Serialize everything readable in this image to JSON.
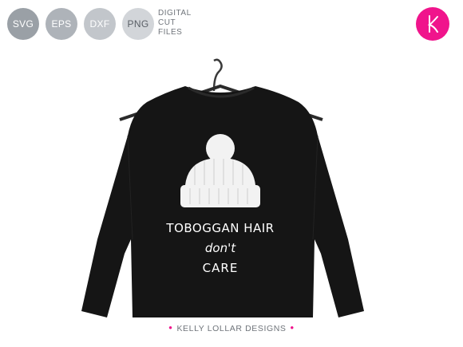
{
  "formats": [
    "SVG",
    "EPS",
    "DXF",
    "PNG"
  ],
  "digital_label": [
    "DIGITAL",
    "CUT",
    "FILES"
  ],
  "logo": {
    "letter": "K",
    "color": "#f0148c"
  },
  "design": {
    "line1": "TOBOGGAN HAIR",
    "line2": "don't",
    "line3": "CARE"
  },
  "footer": {
    "text": "KELLY LOLLAR DESIGNS"
  },
  "colors": {
    "shirt": "#151515",
    "accent": "#f0148c",
    "badge_gray": "#9aa0a6"
  }
}
